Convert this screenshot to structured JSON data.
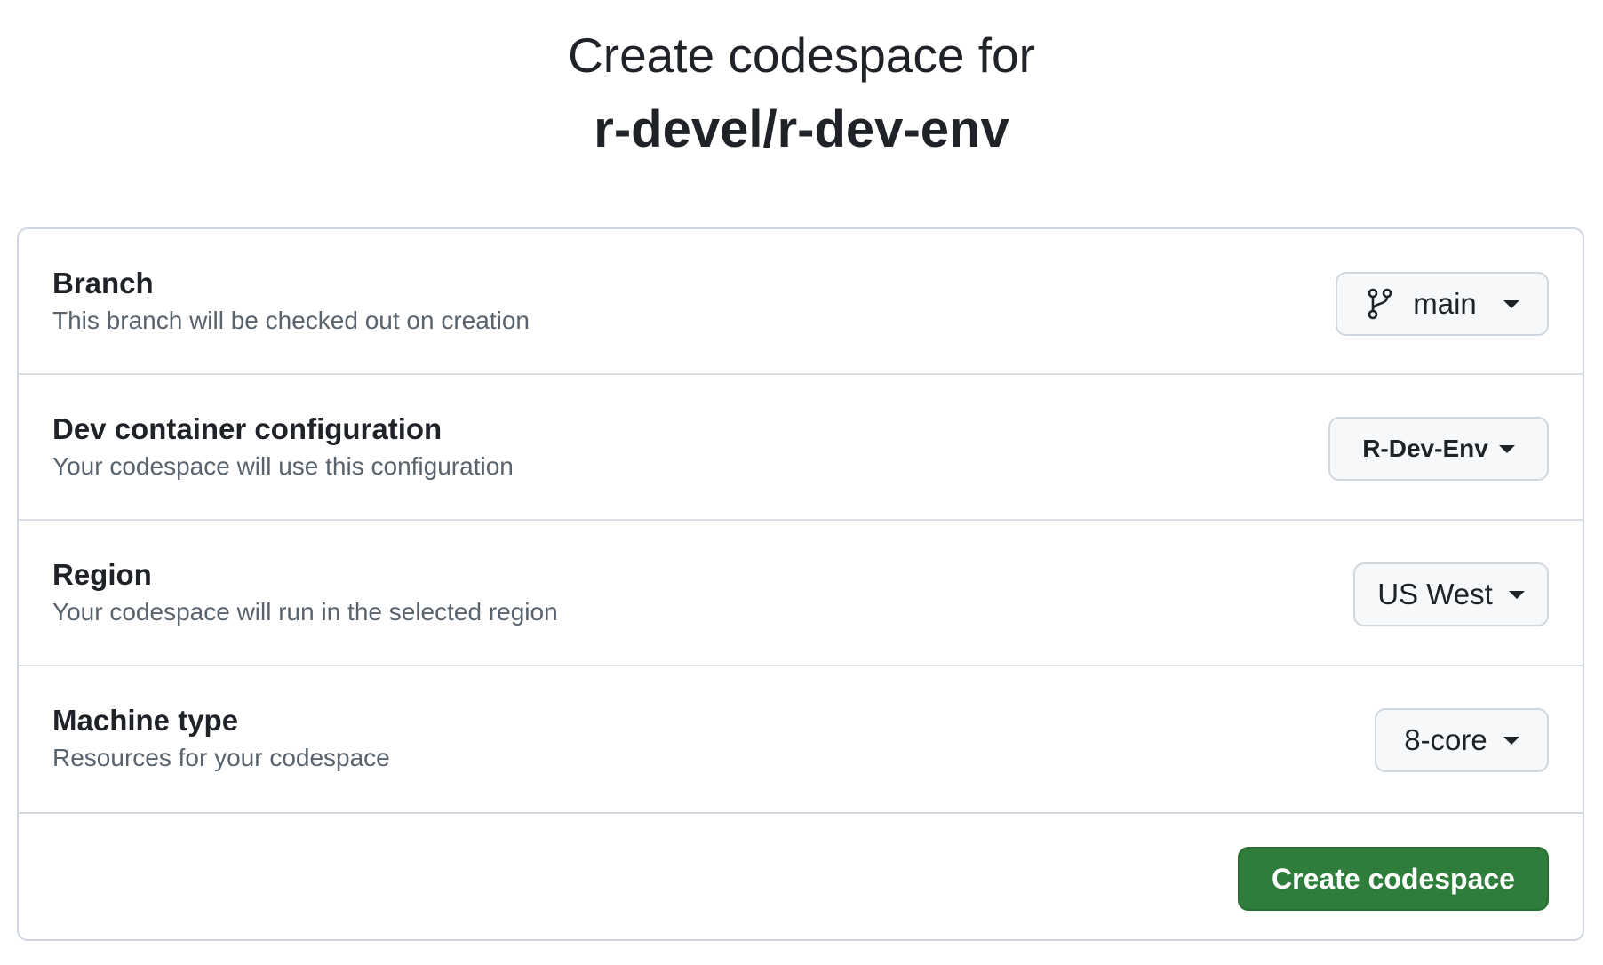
{
  "header": {
    "title": "Create codespace for",
    "repo": "r-devel/r-dev-env"
  },
  "rows": [
    {
      "label": "Branch",
      "description": "This branch will be checked out on creation",
      "value": "main",
      "icon": "git-branch-icon"
    },
    {
      "label": "Dev container configuration",
      "description": "Your codespace will use this configuration",
      "value": "R-Dev-Env"
    },
    {
      "label": "Region",
      "description": "Your codespace will run in the selected region",
      "value": "US West"
    },
    {
      "label": "Machine type",
      "description": "Resources for your codespace",
      "value": "8-core"
    }
  ],
  "footer": {
    "create_label": "Create codespace"
  },
  "colors": {
    "primary_button": "#2f7d3b",
    "border": "#d0d7de",
    "muted_text": "#59636e",
    "dropdown_bg": "#f6f8fa"
  }
}
